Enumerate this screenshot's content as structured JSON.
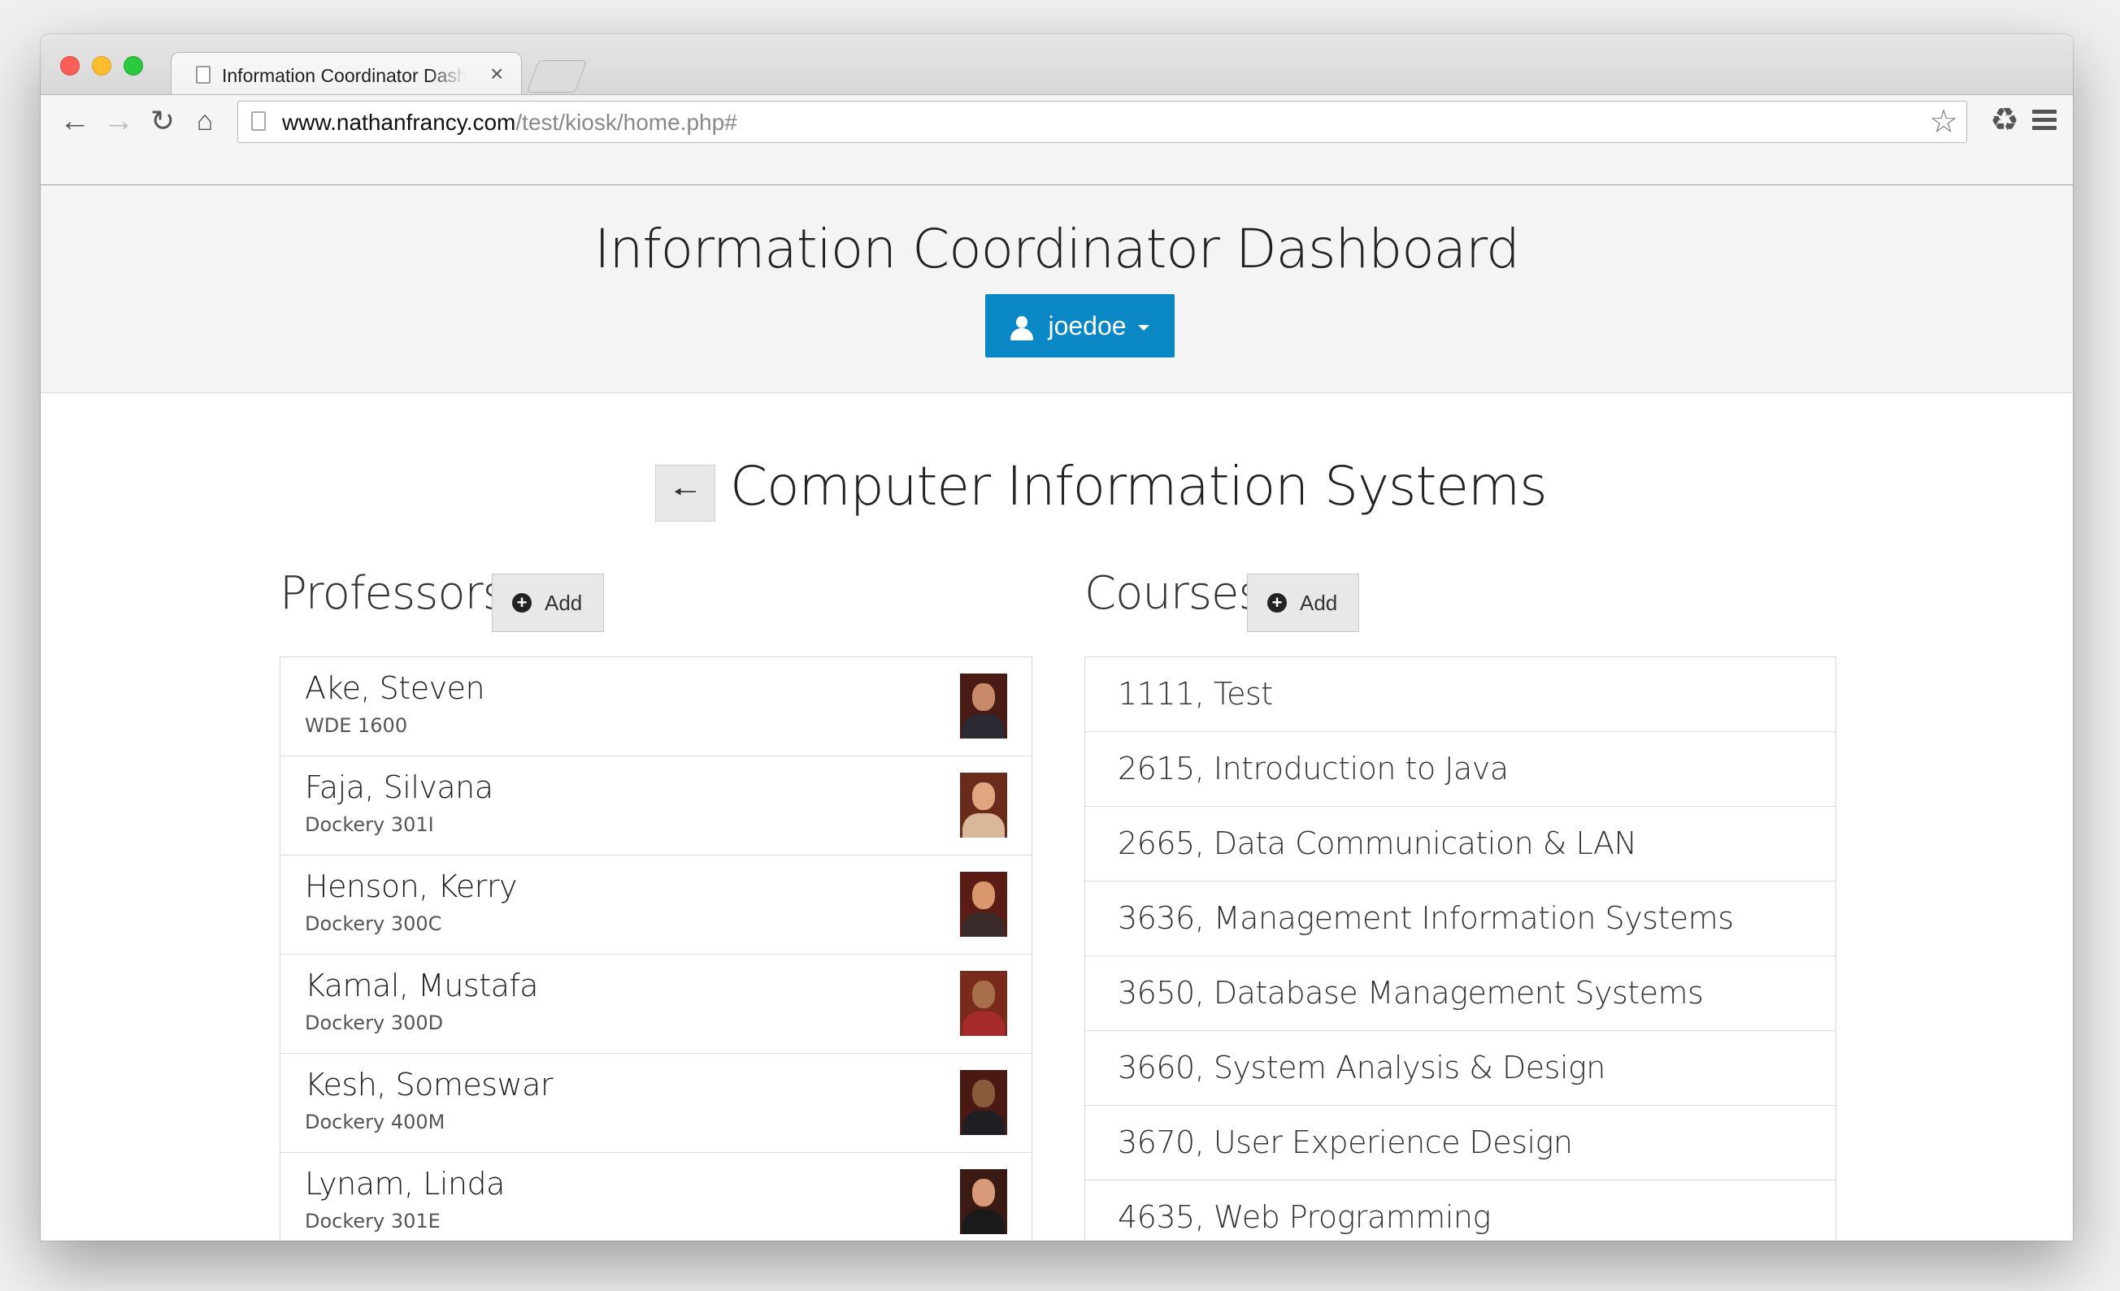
{
  "browser": {
    "tab_title": "Information Coordinator Dashboard",
    "tab_close": "×",
    "url_host": "www.nathanfrancy.com",
    "url_path": "/test/kiosk/home.php#"
  },
  "header": {
    "title": "Information Coordinator Dashboard",
    "user": "joedoe"
  },
  "section": {
    "title": "Computer Information Systems",
    "back_icon": "arrow-left-icon"
  },
  "professors": {
    "title": "Professors",
    "add_label": "Add",
    "items": [
      {
        "name": "Ake, Steven",
        "office": "WDE 1600"
      },
      {
        "name": "Faja, Silvana",
        "office": "Dockery 301I"
      },
      {
        "name": "Henson, Kerry",
        "office": "Dockery 300C"
      },
      {
        "name": "Kamal, Mustafa",
        "office": "Dockery 300D"
      },
      {
        "name": "Kesh, Someswar",
        "office": "Dockery 400M"
      },
      {
        "name": "Lynam, Linda",
        "office": "Dockery 301E"
      }
    ]
  },
  "courses": {
    "title": "Courses",
    "add_label": "Add",
    "items": [
      "1111, Test",
      "2615, Introduction to Java",
      "2665, Data Communication & LAN",
      "3636, Management Information Systems",
      "3650, Database Management Systems",
      "3660, System Analysis & Design",
      "3670, User Experience Design",
      "4635, Web Programming"
    ]
  },
  "colors": {
    "accent": "#0a87c5",
    "header_bg": "#f4f4f4"
  }
}
